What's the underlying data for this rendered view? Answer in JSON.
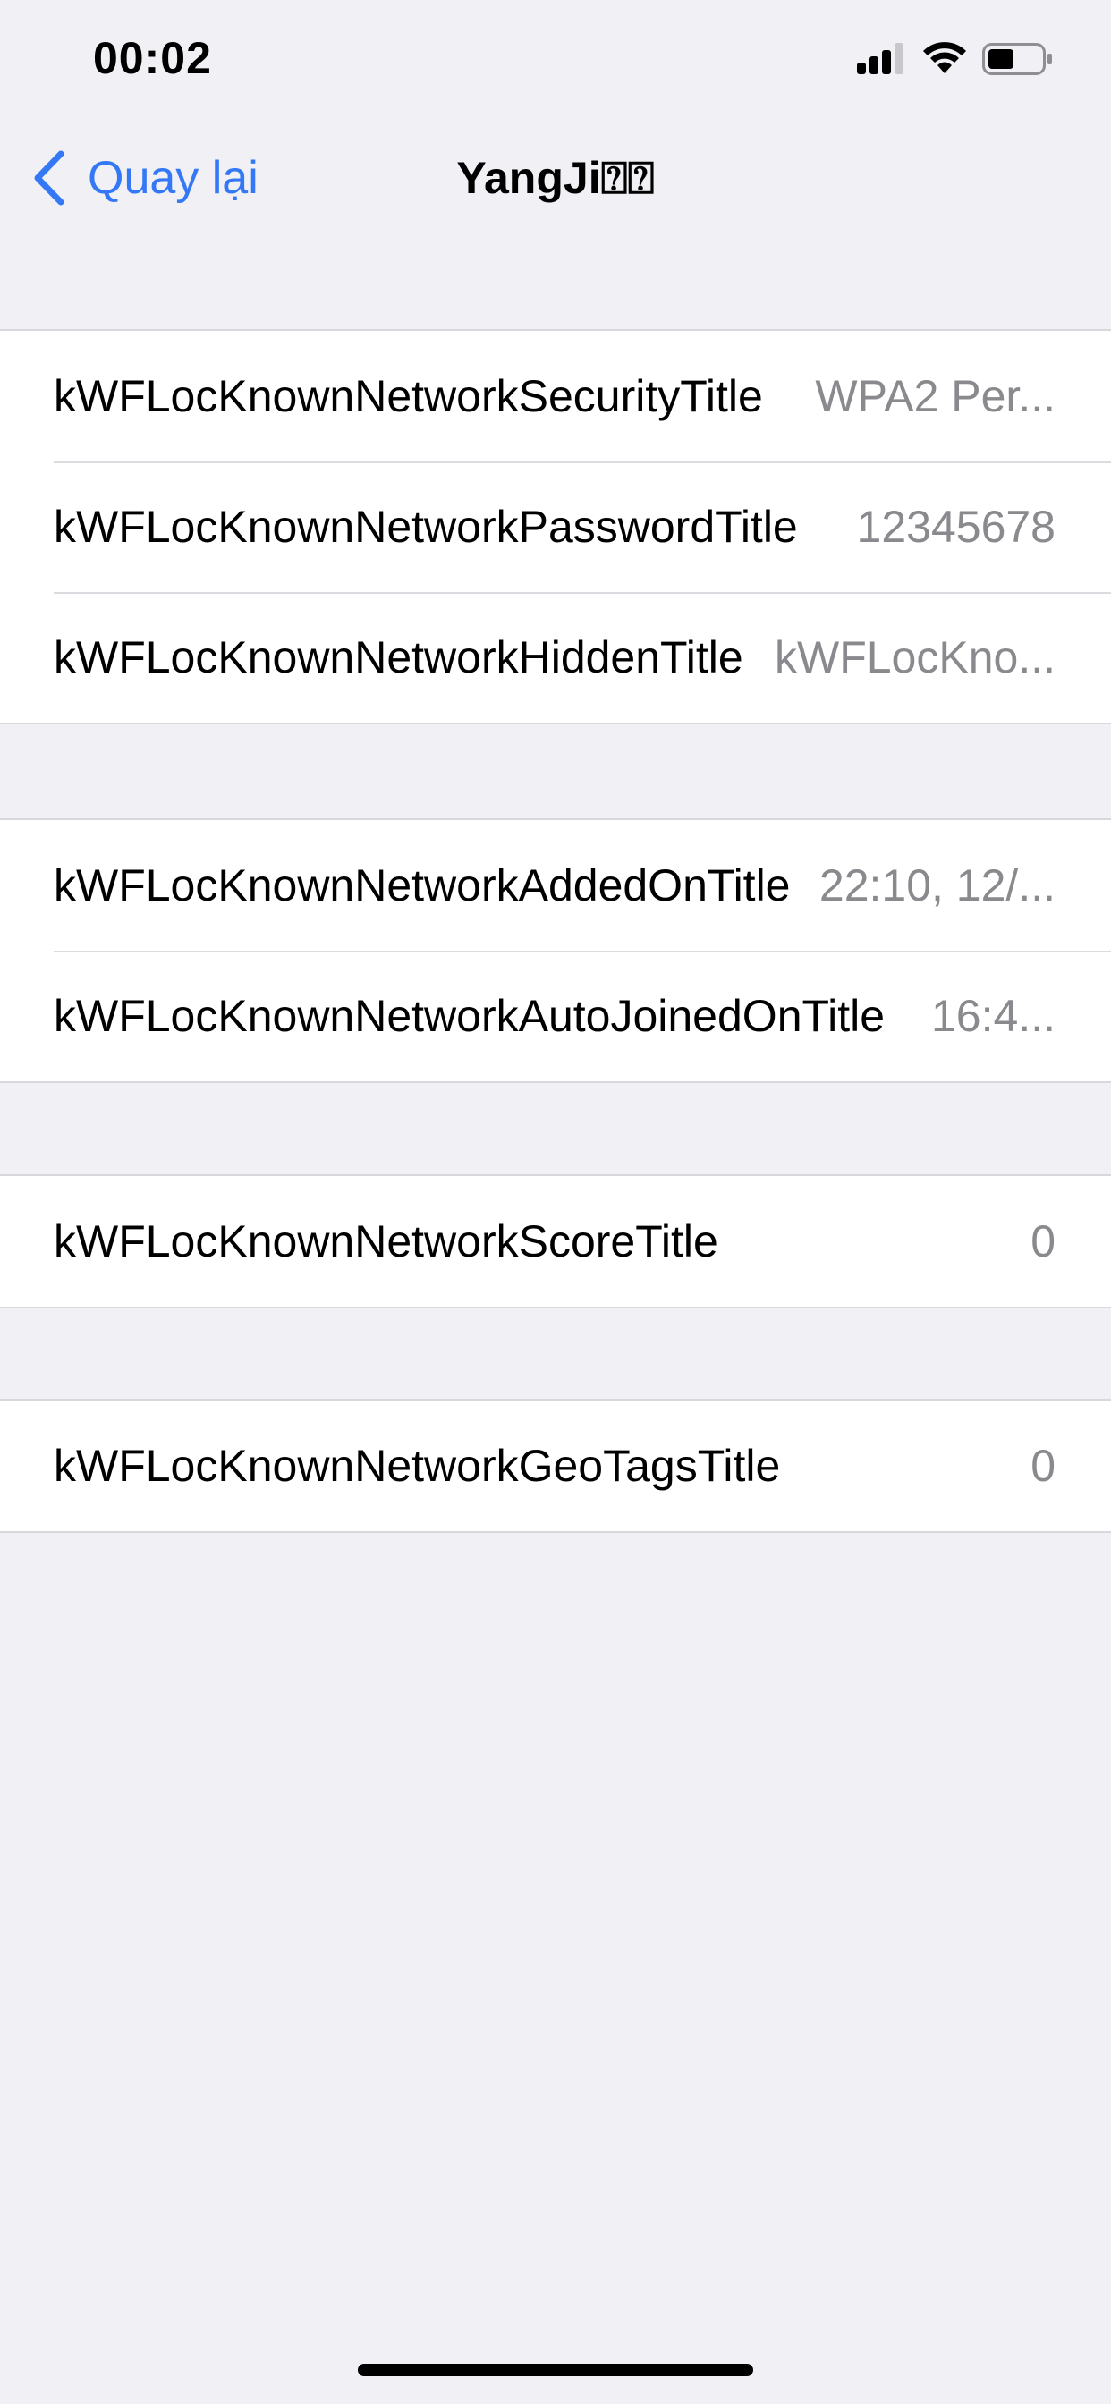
{
  "status_bar": {
    "time": "00:02",
    "icons": [
      "cellular-signal-icon",
      "wifi-icon",
      "battery-icon"
    ]
  },
  "nav": {
    "back_label": "Quay lại",
    "title": "YangJi⍰⍰",
    "accent_color": "#3478f6"
  },
  "groups": [
    {
      "rows": [
        {
          "title": "kWFLocKnownNetworkSecurityTitle",
          "value": "WPA2 Per..."
        },
        {
          "title": "kWFLocKnownNetworkPasswordTitle",
          "value": "12345678"
        },
        {
          "title": "kWFLocKnownNetworkHiddenTitle",
          "value": "kWFLocKno..."
        }
      ]
    },
    {
      "rows": [
        {
          "title": "kWFLocKnownNetworkAddedOnTitle",
          "value": "22:10, 12/..."
        },
        {
          "title": "kWFLocKnownNetworkAutoJoinedOnTitle",
          "value": "16:4..."
        }
      ]
    },
    {
      "rows": [
        {
          "title": "kWFLocKnownNetworkScoreTitle",
          "value": "0"
        }
      ]
    },
    {
      "rows": [
        {
          "title": "kWFLocKnownNetworkGeoTagsTitle",
          "value": "0"
        }
      ]
    }
  ]
}
